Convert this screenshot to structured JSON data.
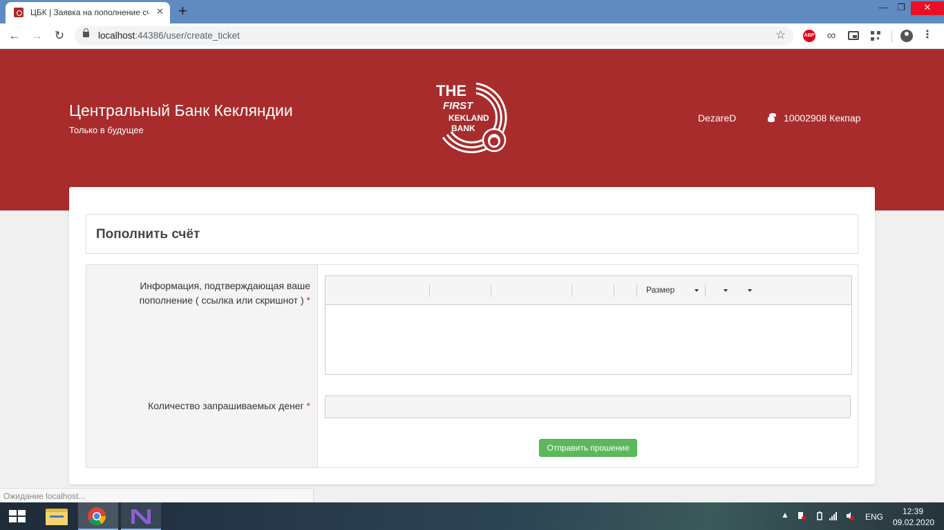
{
  "browser": {
    "tab_title": "ЦБК | Заявка на пополнение сче",
    "tab_close": "✕",
    "new_tab": "+",
    "url_host": "localhost",
    "url_rest": ":44386/user/create_ticket",
    "window_min": "—",
    "window_max": "❐",
    "window_close": "✕",
    "abp_label": "ABP"
  },
  "header": {
    "title": "Центральный Банк Кекляндии",
    "tagline": "Только в будущее",
    "logo_lines": [
      "THE",
      "FIRST",
      "KEKLAND",
      "BANK"
    ],
    "username": "DezareD",
    "balance": "10002908 Кекпар"
  },
  "form": {
    "heading": "Пополнить счёт",
    "info_label": "Информация, подтверждающая ваше пополнение ( ссылка или скришнот )",
    "required_mark": "*",
    "amount_label": "Количество запрашиваемых денег",
    "editor_size_label": "Размер",
    "submit_label": "Отправить прошение"
  },
  "status_bar": "Ожидание localhost...",
  "taskbar": {
    "language": "ENG",
    "time": "12:39",
    "date": "09.02.2020"
  },
  "colors": {
    "brand": "#a82c2c",
    "success": "#5cb85c"
  }
}
